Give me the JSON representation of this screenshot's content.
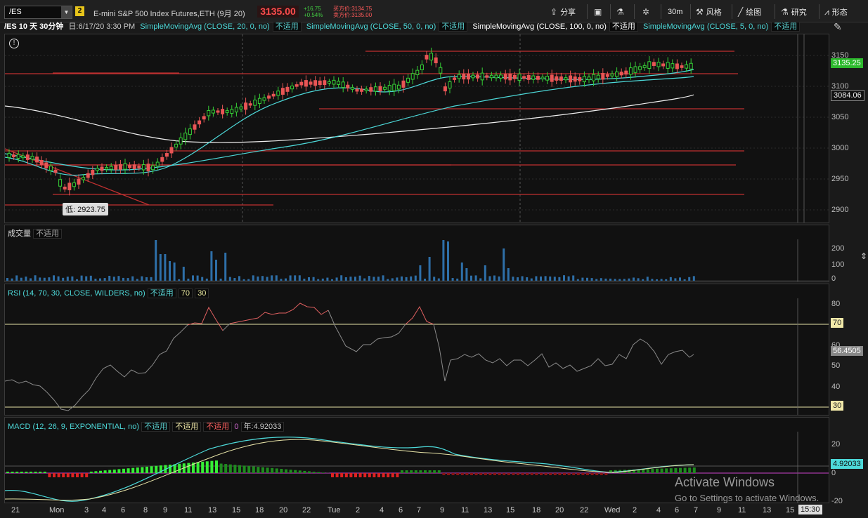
{
  "toolbar": {
    "symbol": "/ES",
    "link_badge": "2",
    "description": "E-mini S&P 500 Index Futures,ETH (9月 20)",
    "last_price": "3135.00",
    "net_change": "+16.75",
    "pct_change": "+0.54%",
    "bid": "买方价:3134.75",
    "ask": "卖方价:3135.00",
    "share_label": "分享",
    "timeframe": "30m",
    "style_label": "风格",
    "drawing_label": "绘图",
    "research_label": "研究",
    "pattern_label": "形态"
  },
  "study_bar": {
    "chart_label": "/ES 10 天 30分钟",
    "date_label": "日:6/17/20 3:30 PM",
    "studies": [
      {
        "name": "SimpleMovingAvg (CLOSE, 20, 0, no)",
        "value": "不适用",
        "color": "#4dd9d9"
      },
      {
        "name": "SimpleMovingAvg (CLOSE, 50, 0, no)",
        "value": "不适用",
        "color": "#4dd9d9"
      },
      {
        "name": "SimpleMovingAvg (CLOSE, 100, 0, no)",
        "value": "不适用",
        "color": "#ffffff"
      },
      {
        "name": "SimpleMovingAvg (CLOSE, 5, 0, no)",
        "value": "不适用",
        "color": "#4dd9d9"
      }
    ]
  },
  "price_pane": {
    "low_label": "低: 2923.75",
    "y_ticks": [
      "3150",
      "3100",
      "3050",
      "3000",
      "2950",
      "2900"
    ],
    "last_tag": "3135.25",
    "sma_tag": "3084.06"
  },
  "volume_pane": {
    "title": "成交量",
    "value": "不适用",
    "y_ticks": [
      "200",
      "100",
      "0"
    ]
  },
  "rsi_pane": {
    "title": "RSI (14, 70, 30, CLOSE, WILDERS, no)",
    "value": "不适用",
    "overbought": "70",
    "oversold": "30",
    "y_ticks": [
      "80",
      "60",
      "50",
      "40"
    ],
    "current_tag": "56.4505",
    "level_tag_70": "70",
    "level_tag_30": "30"
  },
  "macd_pane": {
    "title": "MACD (12, 26, 9, EXPONENTIAL, no)",
    "value1": "不适用",
    "value2": "不适用",
    "value3": "不适用",
    "zero": "0",
    "diff_label": "年:4.92033",
    "y_ticks": [
      "20",
      "0",
      "-20"
    ],
    "current_tag": "4.92033"
  },
  "x_axis": {
    "labels": [
      "21",
      "Mon",
      "3",
      "4",
      "6",
      "8",
      "9",
      "11",
      "13",
      "15",
      "18",
      "20",
      "22",
      "Tue",
      "2",
      "4",
      "6",
      "7",
      "9",
      "11",
      "13",
      "15",
      "18",
      "20",
      "22",
      "Wed",
      "2",
      "4",
      "6",
      "7",
      "9",
      "11",
      "13",
      "15"
    ],
    "time_tag": "15:30"
  },
  "watermark": {
    "line1": "Activate Windows",
    "line2": "Go to Settings to activate Windows."
  },
  "colors": {
    "bull": "#36d036",
    "bear": "#e85555",
    "cyan": "#4dd9d9",
    "level_line": "#c03030",
    "rsi_line": "#8a8a8a",
    "rsi_hot": "#e06060"
  }
}
